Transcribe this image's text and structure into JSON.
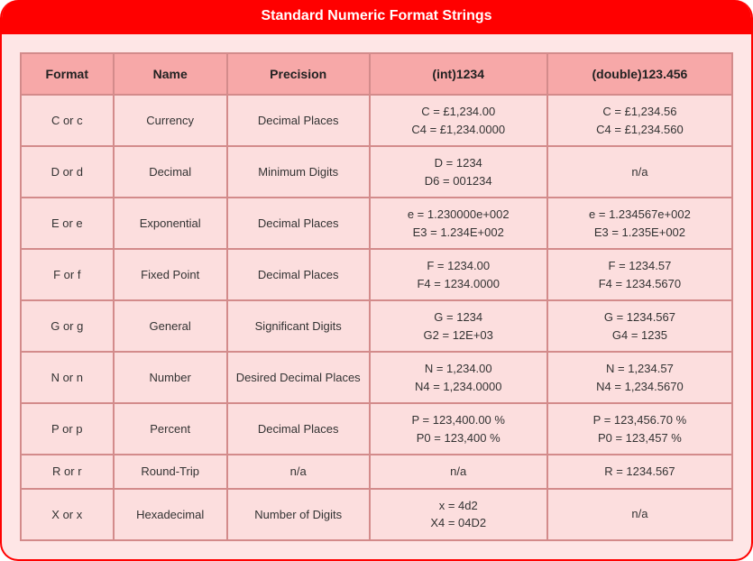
{
  "title": "Standard Numeric Format Strings",
  "columns": [
    "Format",
    "Name",
    "Precision",
    "(int)1234",
    "(double)123.456"
  ],
  "rows": [
    {
      "format": "C or c",
      "name": "Currency",
      "precision": "Decimal Places",
      "int_ex": [
        "C = £1,234.00",
        "C4 = £1,234.0000"
      ],
      "dbl_ex": [
        "C = £1,234.56",
        "C4 = £1,234.560"
      ]
    },
    {
      "format": "D or d",
      "name": "Decimal",
      "precision": "Minimum Digits",
      "int_ex": [
        "D = 1234",
        "D6 = 001234"
      ],
      "dbl_ex": [
        "n/a"
      ]
    },
    {
      "format": "E or e",
      "name": "Exponential",
      "precision": "Decimal Places",
      "int_ex": [
        "e = 1.230000e+002",
        "E3 = 1.234E+002"
      ],
      "dbl_ex": [
        "e = 1.234567e+002",
        "E3 = 1.235E+002"
      ]
    },
    {
      "format": "F or f",
      "name": "Fixed Point",
      "precision": "Decimal Places",
      "int_ex": [
        "F = 1234.00",
        "F4 = 1234.0000"
      ],
      "dbl_ex": [
        "F = 1234.57",
        "F4 = 1234.5670"
      ]
    },
    {
      "format": "G or g",
      "name": "General",
      "precision": "Significant Digits",
      "int_ex": [
        "G = 1234",
        "G2 = 12E+03"
      ],
      "dbl_ex": [
        "G = 1234.567",
        "G4 = 1235"
      ]
    },
    {
      "format": "N or n",
      "name": "Number",
      "precision": "Desired Decimal Places",
      "int_ex": [
        "N = 1,234.00",
        "N4 = 1,234.0000"
      ],
      "dbl_ex": [
        "N = 1,234.57",
        "N4 = 1,234.5670"
      ]
    },
    {
      "format": "P or p",
      "name": "Percent",
      "precision": "Decimal Places",
      "int_ex": [
        "P = 123,400.00 %",
        "P0 = 123,400 %"
      ],
      "dbl_ex": [
        "P = 123,456.70 %",
        "P0 = 123,457 %"
      ]
    },
    {
      "format": "R or r",
      "name": "Round-Trip",
      "precision": "n/a",
      "int_ex": [
        "n/a"
      ],
      "dbl_ex": [
        "R = 1234.567"
      ]
    },
    {
      "format": "X or x",
      "name": "Hexadecimal",
      "precision": "Number of Digits",
      "int_ex": [
        "x = 4d2",
        "X4 = 04D2"
      ],
      "dbl_ex": [
        "n/a"
      ]
    }
  ]
}
